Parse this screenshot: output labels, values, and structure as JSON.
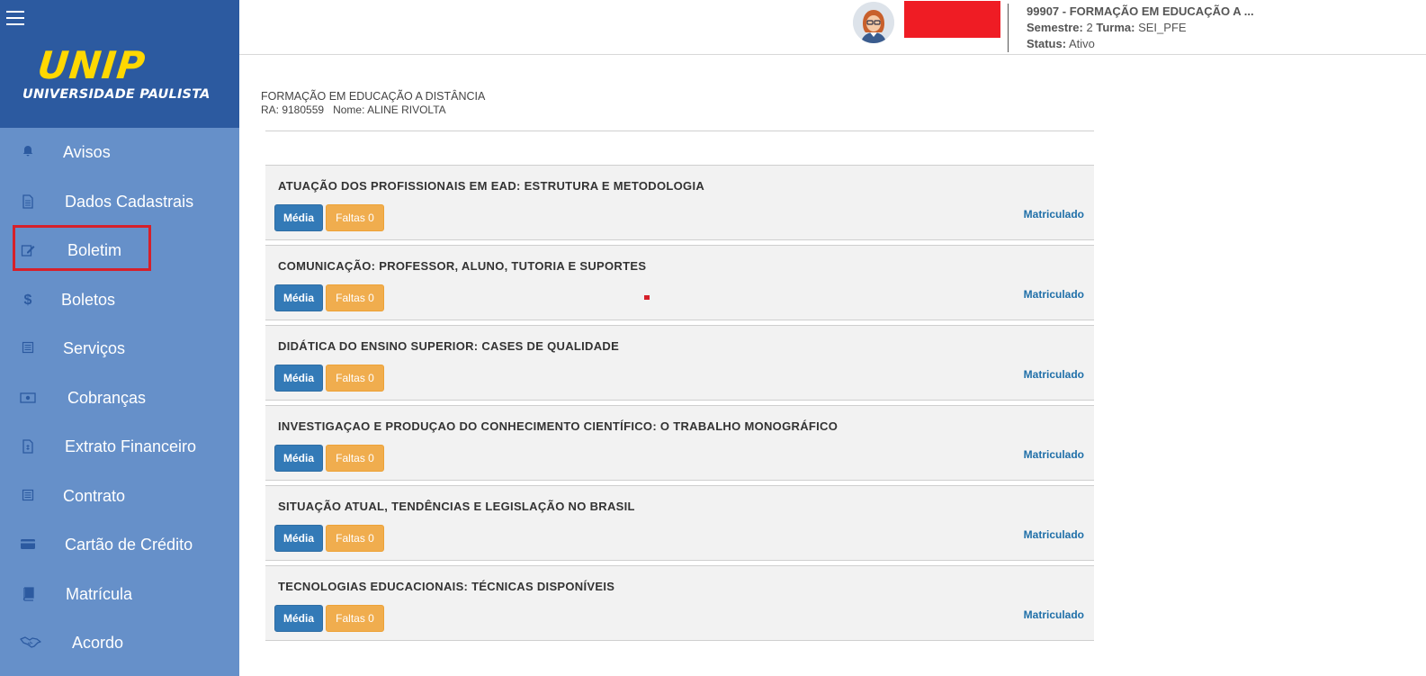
{
  "sidebar": {
    "logo_text": "UNIP",
    "logo_subtitle": "UNIVERSIDADE PAULISTA",
    "items": [
      {
        "label": "Avisos",
        "icon": "bell-icon"
      },
      {
        "label": "Dados Cadastrais",
        "icon": "document-icon"
      },
      {
        "label": "Boletim",
        "icon": "edit-icon"
      },
      {
        "label": "Boletos",
        "icon": "dollar-icon"
      },
      {
        "label": "Serviços",
        "icon": "list-icon"
      },
      {
        "label": "Cobranças",
        "icon": "money-icon"
      },
      {
        "label": "Extrato Financeiro",
        "icon": "financial-document-icon"
      },
      {
        "label": "Contrato",
        "icon": "list-icon"
      },
      {
        "label": "Cartão de Crédito",
        "icon": "credit-card-icon"
      },
      {
        "label": "Matrícula",
        "icon": "book-icon"
      },
      {
        "label": "Acordo",
        "icon": "handshake-icon"
      }
    ],
    "highlight_color": "#d6202a"
  },
  "header": {
    "course": "99907 - FORMAÇÃO EM EDUCAÇÃO A ...",
    "semester_label": "Semestre:",
    "semester_value": "2",
    "class_label": "Turma:",
    "class_value": "SEI_PFE",
    "status_label": "Status:",
    "status_value": "Ativo"
  },
  "main": {
    "course_title": "FORMAÇÃO EM EDUCAÇÃO A DISTÂNCIA",
    "ra": "RA: 9180559",
    "name": "Nome: ALINE RIVOLTA"
  },
  "disciplines": [
    {
      "name": "ATUAÇÃO DOS PROFISSIONAIS EM EAD: ESTRUTURA E METODOLOGIA",
      "media": "Média",
      "faltas": "Faltas 0",
      "status": "Matriculado"
    },
    {
      "name": "COMUNICAÇÃO: PROFESSOR, ALUNO, TUTORIA E SUPORTES",
      "media": "Média",
      "faltas": "Faltas 0",
      "status": "Matriculado"
    },
    {
      "name": "DIDÁTICA DO ENSINO SUPERIOR: CASES DE QUALIDADE",
      "media": "Média",
      "faltas": "Faltas 0",
      "status": "Matriculado"
    },
    {
      "name": "INVESTIGAÇAO E PRODUÇAO DO CONHECIMENTO CIENTÍFICO: O TRABALHO MONOGRÁFICO",
      "media": "Média",
      "faltas": "Faltas 0",
      "status": "Matriculado"
    },
    {
      "name": "SITUAÇÃO ATUAL, TENDÊNCIAS E LEGISLAÇÃO NO BRASIL",
      "media": "Média",
      "faltas": "Faltas 0",
      "status": "Matriculado"
    },
    {
      "name": "TECNOLOGIAS EDUCACIONAIS: TÉCNICAS DISPONÍVEIS",
      "media": "Média",
      "faltas": "Faltas 0",
      "status": "Matriculado"
    }
  ],
  "colors": {
    "sidebar_top": "#2c5aa0",
    "sidebar_bg": "#6690c9",
    "logo_yellow": "#ffd800",
    "media_button": "#337ab7",
    "faltas_button": "#f0ad4e",
    "status_text": "#1f6fa8",
    "redacted_box": "#ef1c24"
  }
}
